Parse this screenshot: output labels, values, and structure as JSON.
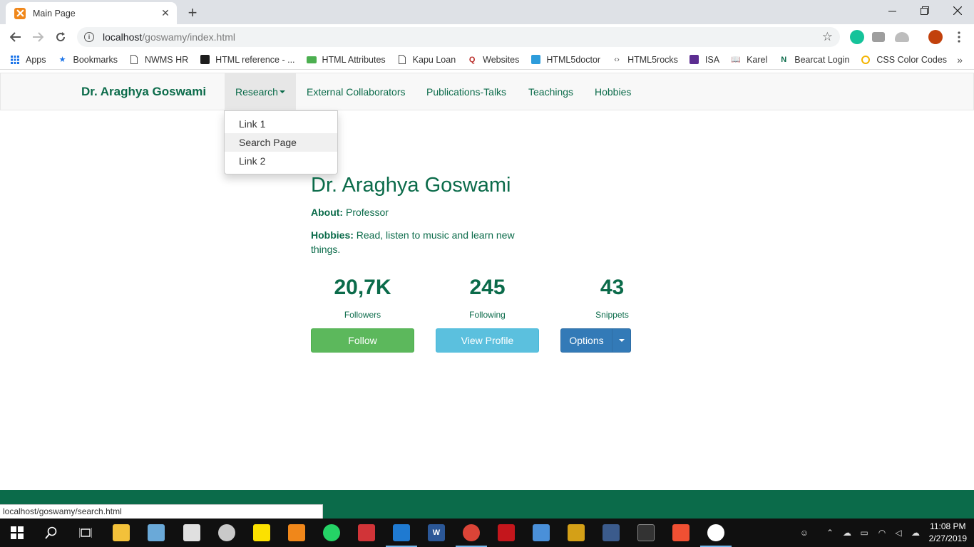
{
  "browser": {
    "tab_title": "Main Page",
    "url_host": "localhost",
    "url_path": "/goswamy/index.html",
    "status_url": "localhost/goswamy/search.html",
    "bookmarks": [
      {
        "label": "Apps",
        "icon": "apps-grid-icon"
      },
      {
        "label": "Bookmarks",
        "icon": "star-icon"
      },
      {
        "label": "NWMS HR",
        "icon": "page-icon"
      },
      {
        "label": "HTML reference - ...",
        "icon": "mdn-icon"
      },
      {
        "label": "HTML Attributes",
        "icon": "w3schools-icon"
      },
      {
        "label": "Kapu Loan",
        "icon": "page-icon"
      },
      {
        "label": "Websites",
        "icon": "quora-icon"
      },
      {
        "label": "HTML5doctor",
        "icon": "html5doctor-icon"
      },
      {
        "label": "HTML5rocks",
        "icon": "html5rocks-icon"
      },
      {
        "label": "ISA",
        "icon": "isa-icon"
      },
      {
        "label": "Karel",
        "icon": "book-icon"
      },
      {
        "label": "Bearcat Login",
        "icon": "northwest-icon"
      },
      {
        "label": "CSS Color Codes",
        "icon": "search-icon"
      }
    ]
  },
  "navbar": {
    "brand": "Dr. Araghya Goswami",
    "items": [
      "Research",
      "External Collaborators",
      "Publications-Talks",
      "Teachings",
      "Hobbies"
    ],
    "dropdown": [
      "Link 1",
      "Search Page",
      "Link 2"
    ]
  },
  "profile": {
    "name": "Dr. Araghya Goswami",
    "about_label": "About:",
    "about_value": "Professor",
    "hobbies_label": "Hobbies:",
    "hobbies_value": "Read, listen to music and learn new things.",
    "stats": [
      {
        "value": "20,7K",
        "label": "Followers"
      },
      {
        "value": "245",
        "label": "Following"
      },
      {
        "value": "43",
        "label": "Snippets"
      }
    ],
    "buttons": {
      "follow": "Follow",
      "view": "View Profile",
      "options": "Options"
    }
  },
  "taskbar": {
    "time": "11:08 PM",
    "date": "2/27/2019"
  },
  "colors": {
    "accent": "#0b6b4a",
    "follow": "#5cb85c",
    "view": "#5bc0de",
    "options": "#337ab7"
  }
}
